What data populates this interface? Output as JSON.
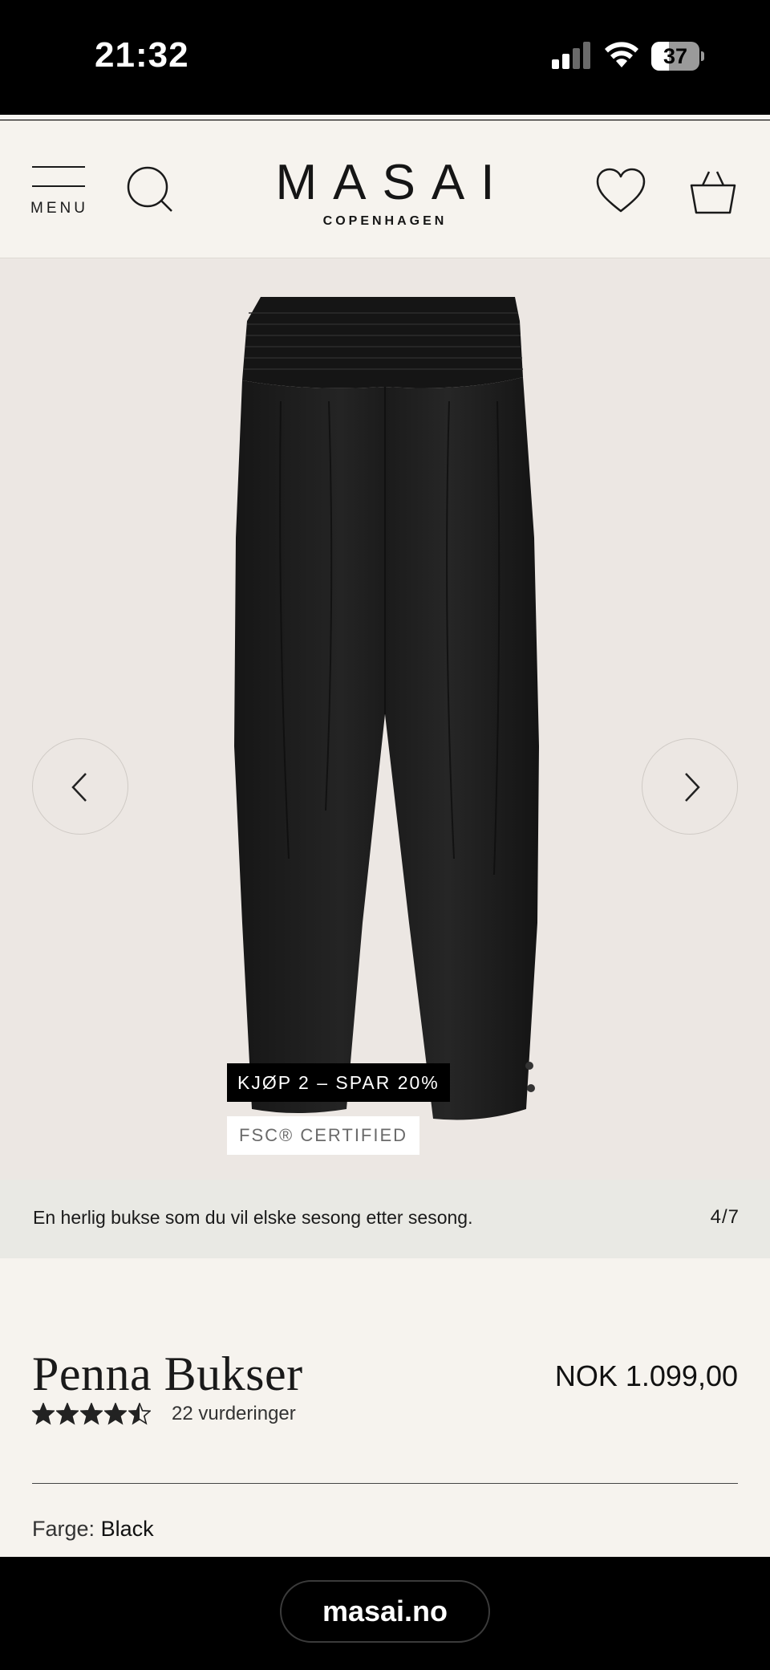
{
  "status_bar": {
    "time": "21:32",
    "battery_level": "37",
    "battery_fraction": 0.37
  },
  "header": {
    "menu_label": "MENU",
    "brand_name": "MASAI",
    "brand_sub": "COPENHAGEN",
    "icons": [
      "hamburger-icon",
      "search-icon",
      "heart-icon",
      "basket-icon"
    ]
  },
  "gallery": {
    "badge_offer": "KJØP 2 – SPAR 20%",
    "badge_cert": "FSC® CERTIFIED",
    "caption": "En herlig bukse som du vil elske sesong etter sesong.",
    "counter": "4/7",
    "icons": [
      "chevron-left-icon",
      "chevron-right-icon"
    ]
  },
  "product": {
    "title": "Penna Bukser",
    "price": "NOK 1.099,00",
    "rating_stars": 4.5,
    "rating_max": 5,
    "reviews_label": "22 vurderinger",
    "color_label": "Farge:",
    "color_value": "Black"
  },
  "browser": {
    "url": "masai.no"
  },
  "colors": {
    "page_bg": "#f6f3ee",
    "gallery_bg": "#ece7e3",
    "caption_bg": "#e9e9e4",
    "text": "#1a1a1a"
  }
}
